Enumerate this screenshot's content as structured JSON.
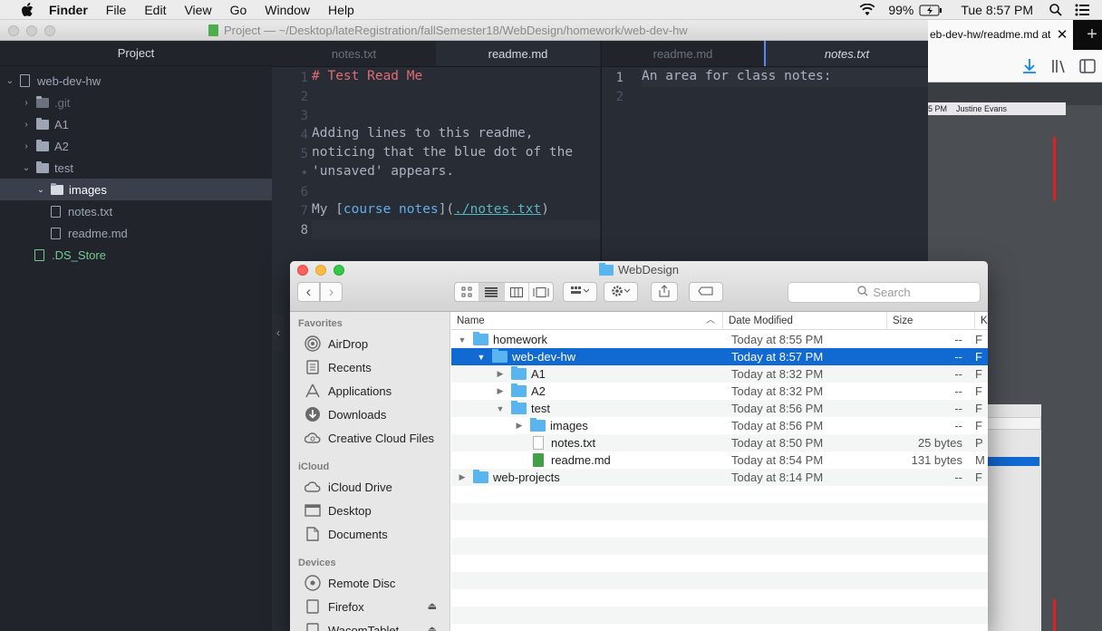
{
  "menubar": {
    "app": "Finder",
    "items": [
      "File",
      "Edit",
      "View",
      "Go",
      "Window",
      "Help"
    ],
    "battery": "99%",
    "clock": "Tue 8:57 PM"
  },
  "atom": {
    "title": "Project — ~/Desktop/lateRegistration/fallSemester18/WebDesign/homework/web-dev-hw",
    "tree_header": "Project",
    "tree": {
      "root": "web-dev-hw",
      "git": ".git",
      "a1": "A1",
      "a2": "A2",
      "test": "test",
      "images": "images",
      "notes": "notes.txt",
      "readme": "readme.md",
      "ds": ".DS_Store"
    },
    "left_pane": {
      "tabs": [
        "notes.txt",
        "readme.md"
      ],
      "gutter": [
        "1",
        "2",
        "3",
        "4",
        "5",
        "•",
        "6",
        "7",
        "8"
      ],
      "lines": {
        "l1": "# Test Read Me",
        "l4": "Adding lines to this readme,",
        "l5": "noticing that the blue dot of the",
        "l5b": "'unsaved' appears.",
        "l7_prefix": "My [",
        "l7_text": "course notes",
        "l7_mid": "](",
        "l7_url": "./notes.txt",
        "l7_end": ")"
      }
    },
    "right_pane": {
      "tabs": [
        "readme.md",
        "notes.txt"
      ],
      "gutter": [
        "1",
        "2"
      ],
      "l1": "An area for class notes:"
    }
  },
  "firefox": {
    "tab_title": "eb-dev-hw/readme.md at",
    "close": "✕",
    "newtab": "+",
    "strip_time": "5 PM",
    "strip_user": "Justine Evans"
  },
  "finder": {
    "title": "WebDesign",
    "search_placeholder": "Search",
    "sidebar": {
      "favorites_head": "Favorites",
      "favorites": [
        "AirDrop",
        "Recents",
        "Applications",
        "Downloads",
        "Creative Cloud Files"
      ],
      "icloud_head": "iCloud",
      "icloud": [
        "iCloud Drive",
        "Desktop",
        "Documents"
      ],
      "devices_head": "Devices",
      "devices": [
        "Remote Disc",
        "Firefox",
        "WacomTablet"
      ]
    },
    "columns": {
      "name": "Name",
      "date": "Date Modified",
      "size": "Size",
      "kind": "K"
    },
    "rows": [
      {
        "name": "homework",
        "date": "Today at 8:55 PM",
        "size": "--",
        "kind": "F"
      },
      {
        "name": "web-dev-hw",
        "date": "Today at 8:57 PM",
        "size": "--",
        "kind": "F"
      },
      {
        "name": "A1",
        "date": "Today at 8:32 PM",
        "size": "--",
        "kind": "F"
      },
      {
        "name": "A2",
        "date": "Today at 8:32 PM",
        "size": "--",
        "kind": "F"
      },
      {
        "name": "test",
        "date": "Today at 8:56 PM",
        "size": "--",
        "kind": "F"
      },
      {
        "name": "images",
        "date": "Today at 8:56 PM",
        "size": "--",
        "kind": "F"
      },
      {
        "name": "notes.txt",
        "date": "Today at 8:50 PM",
        "size": "25 bytes",
        "kind": "P"
      },
      {
        "name": "readme.md",
        "date": "Today at 8:54 PM",
        "size": "131 bytes",
        "kind": "M"
      },
      {
        "name": "web-projects",
        "date": "Today at 8:14 PM",
        "size": "--",
        "kind": "F"
      }
    ]
  }
}
